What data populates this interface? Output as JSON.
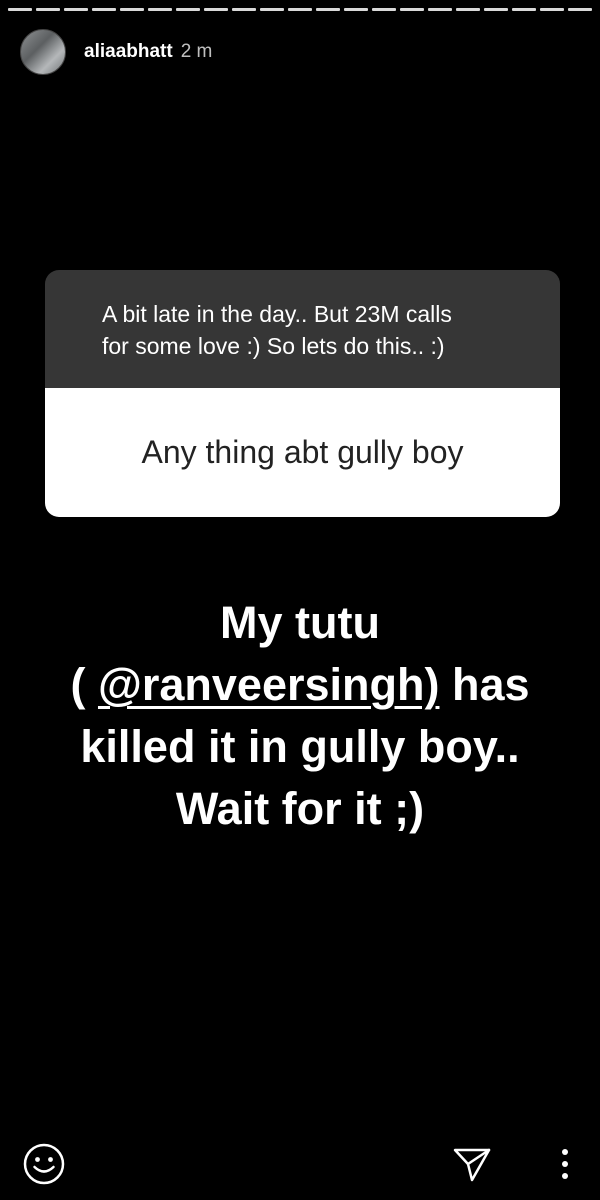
{
  "story": {
    "progress_segments": 21,
    "username": "aliaabhatt",
    "timestamp": "2 m"
  },
  "question_sticker": {
    "prompt_line1": "A bit late in the day.. But 23M calls",
    "prompt_line2": "for some love :) So lets do this.. :)",
    "answer": "Any thing abt gully boy"
  },
  "story_text": {
    "line1": "My tutu",
    "line2_open": "( ",
    "mention": "@ranveersingh)",
    "line2_close": " has",
    "line3": "killed it in gully boy..",
    "line4": "Wait for it ;)"
  },
  "footer": {
    "emoji_icon": "smiley-icon",
    "send_icon": "send-icon",
    "more_icon": "more-vertical-icon"
  },
  "colors": {
    "background": "#000000",
    "question_header_bg": "#363636",
    "question_answer_bg": "#ffffff"
  }
}
